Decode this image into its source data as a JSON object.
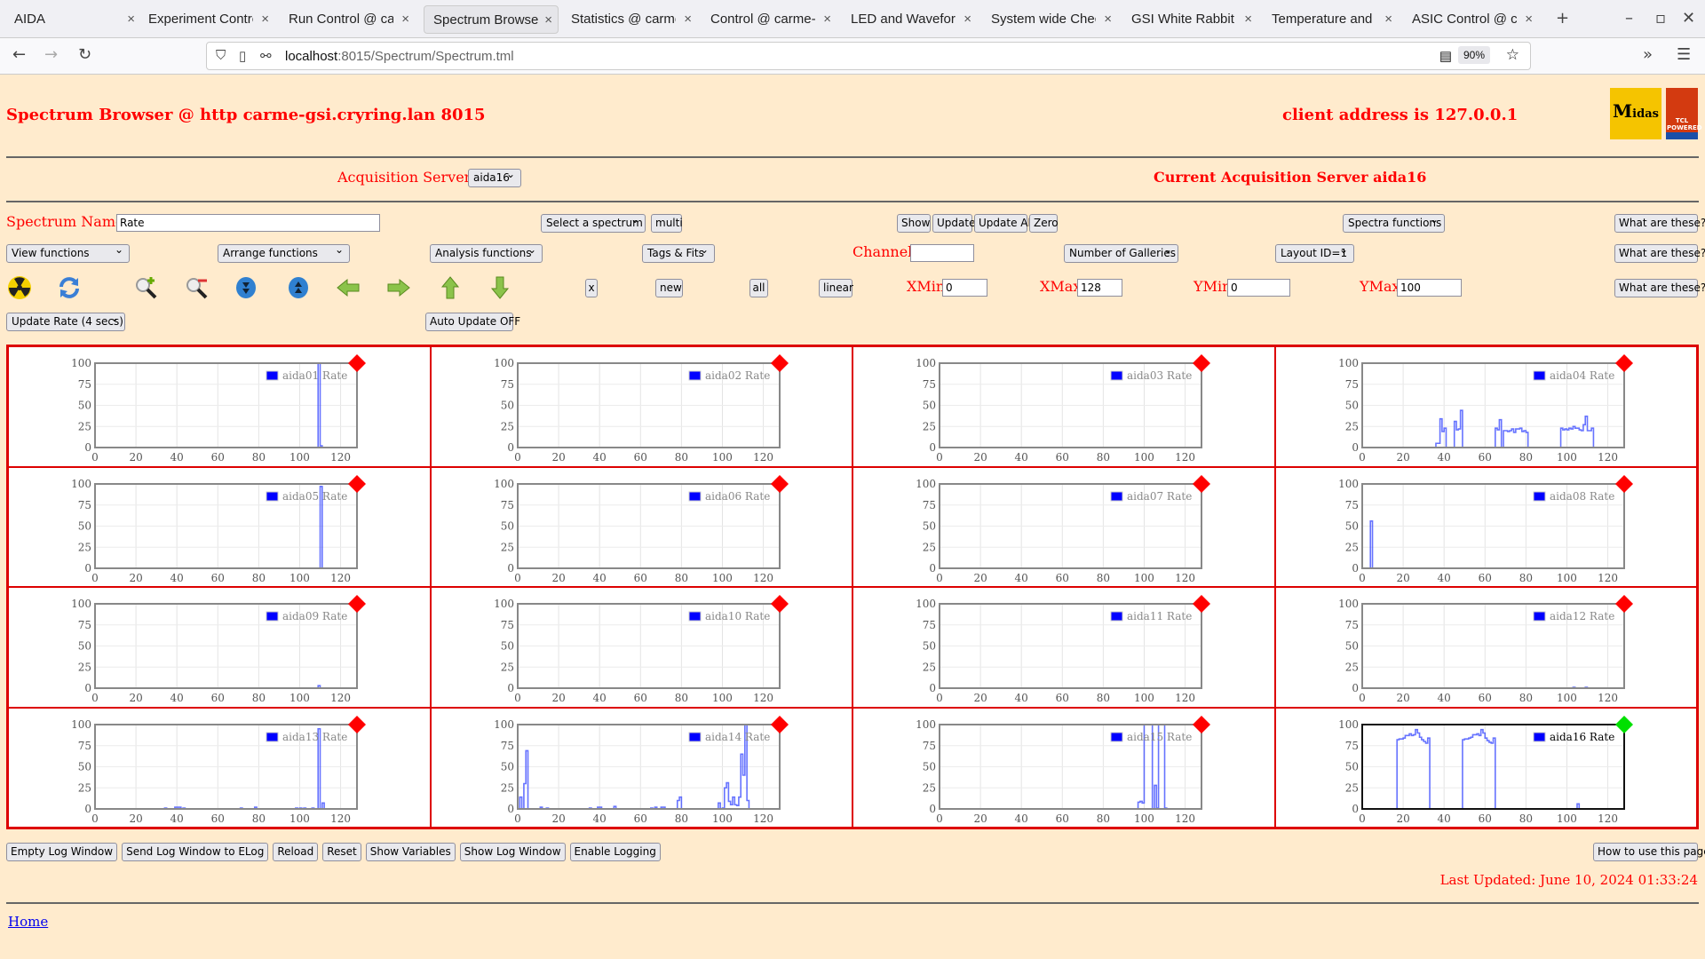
{
  "browser": {
    "tabs": [
      {
        "label": "AIDA"
      },
      {
        "label": "Experiment Control"
      },
      {
        "label": "Run Control @ carme"
      },
      {
        "label": "Spectrum Browser",
        "active": true
      },
      {
        "label": "Statistics @ carme"
      },
      {
        "label": "Control @ carme-gsi"
      },
      {
        "label": "LED and Waveform"
      },
      {
        "label": "System wide Check"
      },
      {
        "label": "GSI White Rabbit T"
      },
      {
        "label": "Temperature and st"
      },
      {
        "label": "ASIC Control @ carme"
      }
    ],
    "url_host": "localhost",
    "url_path": ":8015/Spectrum/Spectrum.tml",
    "zoom": "90%"
  },
  "header": {
    "title": "Spectrum Browser @ http carme-gsi.cryring.lan 8015",
    "client": "client address is 127.0.0.1",
    "logo_text": "Midas",
    "logo2_text": "TCL POWERED"
  },
  "acq": {
    "label": "Acquisition Servers",
    "selected": "aida16",
    "current": "Current Acquisition Server aida16"
  },
  "controls": {
    "spectrum_name_label": "Spectrum Name:",
    "spectrum_name": "Rate",
    "select_spectrum": "Select a spectrum",
    "multi": "multi",
    "show": "Show",
    "update": "Update",
    "update_all": "Update All",
    "zero": "Zero",
    "spectra_functions": "Spectra functions",
    "what": "What are these?",
    "view_functions": "View functions",
    "arrange_functions": "Arrange functions",
    "analysis_functions": "Analysis functions",
    "tags_fits": "Tags & Fits",
    "channel_label": "Channel:",
    "channel": "",
    "galleries": "Number of Galleries",
    "layout": "Layout ID=1",
    "x": "x",
    "new": "new",
    "all": "all",
    "linear": "linear",
    "xmin_label": "XMin",
    "xmin": "0",
    "xmax_label": "XMax",
    "xmax": "128",
    "ymin_label": "YMin",
    "ymin": "0",
    "ymax_label": "YMax",
    "ymax": "100",
    "update_rate": "Update Rate (4 secs)",
    "auto_update": "Auto Update OFF",
    "icons": [
      "radiation-icon",
      "refresh-icon",
      "zoom-in-icon",
      "zoom-out-icon",
      "expand-down-icon",
      "expand-up-icon",
      "arrow-left-icon",
      "arrow-right-icon",
      "arrow-up-icon",
      "arrow-down-icon"
    ]
  },
  "chart_data": [
    {
      "type": "line",
      "legend": "aida01 Rate",
      "status_color": "#ff0000",
      "xlim": [
        0,
        128
      ],
      "ylim": [
        0,
        100
      ],
      "xticks": [
        0,
        20,
        40,
        60,
        80,
        100,
        120
      ],
      "yticks": [
        0,
        25,
        50,
        75,
        100
      ],
      "nonzero_bins": [
        [
          109,
          100
        ],
        [
          110,
          2
        ]
      ]
    },
    {
      "type": "line",
      "legend": "aida02 Rate",
      "status_color": "#ff0000",
      "xlim": [
        0,
        128
      ],
      "ylim": [
        0,
        100
      ],
      "xticks": [
        0,
        20,
        40,
        60,
        80,
        100,
        120
      ],
      "yticks": [
        0,
        25,
        50,
        75,
        100
      ],
      "nonzero_bins": []
    },
    {
      "type": "line",
      "legend": "aida03 Rate",
      "status_color": "#ff0000",
      "xlim": [
        0,
        128
      ],
      "ylim": [
        0,
        100
      ],
      "xticks": [
        0,
        20,
        40,
        60,
        80,
        100,
        120
      ],
      "yticks": [
        0,
        25,
        50,
        75,
        100
      ],
      "nonzero_bins": []
    },
    {
      "type": "line",
      "legend": "aida04 Rate",
      "status_color": "#ff0000",
      "xlim": [
        0,
        128
      ],
      "ylim": [
        0,
        100
      ],
      "xticks": [
        0,
        20,
        40,
        60,
        80,
        100,
        120
      ],
      "yticks": [
        0,
        25,
        50,
        75,
        100
      ],
      "nonzero_bins": [
        [
          36,
          5
        ],
        [
          37,
          5
        ],
        [
          38,
          34
        ],
        [
          39,
          19
        ],
        [
          40,
          23
        ],
        [
          45,
          31
        ],
        [
          46,
          21
        ],
        [
          47,
          22
        ],
        [
          48,
          44
        ],
        [
          65,
          23
        ],
        [
          66,
          21
        ],
        [
          67,
          33
        ],
        [
          69,
          20
        ],
        [
          70,
          20
        ],
        [
          71,
          19
        ],
        [
          72,
          20
        ],
        [
          73,
          22
        ],
        [
          74,
          18
        ],
        [
          75,
          22
        ],
        [
          76,
          22
        ],
        [
          77,
          23
        ],
        [
          78,
          19
        ],
        [
          79,
          20
        ],
        [
          80,
          18
        ],
        [
          97,
          23
        ],
        [
          98,
          21
        ],
        [
          99,
          22
        ],
        [
          100,
          21
        ],
        [
          101,
          23
        ],
        [
          102,
          22
        ],
        [
          103,
          25
        ],
        [
          104,
          23
        ],
        [
          105,
          23
        ],
        [
          106,
          21
        ],
        [
          107,
          20
        ],
        [
          108,
          27
        ],
        [
          109,
          37
        ],
        [
          110,
          20
        ],
        [
          111,
          20
        ],
        [
          112,
          23
        ]
      ]
    },
    {
      "type": "line",
      "legend": "aida05 Rate",
      "status_color": "#ff0000",
      "xlim": [
        0,
        128
      ],
      "ylim": [
        0,
        100
      ],
      "xticks": [
        0,
        20,
        40,
        60,
        80,
        100,
        120
      ],
      "yticks": [
        0,
        25,
        50,
        75,
        100
      ],
      "nonzero_bins": [
        [
          110,
          97
        ]
      ]
    },
    {
      "type": "line",
      "legend": "aida06 Rate",
      "status_color": "#ff0000",
      "xlim": [
        0,
        128
      ],
      "ylim": [
        0,
        100
      ],
      "xticks": [
        0,
        20,
        40,
        60,
        80,
        100,
        120
      ],
      "yticks": [
        0,
        25,
        50,
        75,
        100
      ],
      "nonzero_bins": []
    },
    {
      "type": "line",
      "legend": "aida07 Rate",
      "status_color": "#ff0000",
      "xlim": [
        0,
        128
      ],
      "ylim": [
        0,
        100
      ],
      "xticks": [
        0,
        20,
        40,
        60,
        80,
        100,
        120
      ],
      "yticks": [
        0,
        25,
        50,
        75,
        100
      ],
      "nonzero_bins": []
    },
    {
      "type": "line",
      "legend": "aida08 Rate",
      "status_color": "#ff0000",
      "xlim": [
        0,
        128
      ],
      "ylim": [
        0,
        100
      ],
      "xticks": [
        0,
        20,
        40,
        60,
        80,
        100,
        120
      ],
      "yticks": [
        0,
        25,
        50,
        75,
        100
      ],
      "nonzero_bins": [
        [
          4,
          56
        ]
      ]
    },
    {
      "type": "line",
      "legend": "aida09 Rate",
      "status_color": "#ff0000",
      "xlim": [
        0,
        128
      ],
      "ylim": [
        0,
        100
      ],
      "xticks": [
        0,
        20,
        40,
        60,
        80,
        100,
        120
      ],
      "yticks": [
        0,
        25,
        50,
        75,
        100
      ],
      "nonzero_bins": [
        [
          109,
          3
        ]
      ]
    },
    {
      "type": "line",
      "legend": "aida10 Rate",
      "status_color": "#ff0000",
      "xlim": [
        0,
        128
      ],
      "ylim": [
        0,
        100
      ],
      "xticks": [
        0,
        20,
        40,
        60,
        80,
        100,
        120
      ],
      "yticks": [
        0,
        25,
        50,
        75,
        100
      ],
      "nonzero_bins": []
    },
    {
      "type": "line",
      "legend": "aida11 Rate",
      "status_color": "#ff0000",
      "xlim": [
        0,
        128
      ],
      "ylim": [
        0,
        100
      ],
      "xticks": [
        0,
        20,
        40,
        60,
        80,
        100,
        120
      ],
      "yticks": [
        0,
        25,
        50,
        75,
        100
      ],
      "nonzero_bins": []
    },
    {
      "type": "line",
      "legend": "aida12 Rate",
      "status_color": "#ff0000",
      "xlim": [
        0,
        128
      ],
      "ylim": [
        0,
        100
      ],
      "xticks": [
        0,
        20,
        40,
        60,
        80,
        100,
        120
      ],
      "yticks": [
        0,
        25,
        50,
        75,
        100
      ],
      "nonzero_bins": [
        [
          103,
          1
        ],
        [
          109,
          1
        ]
      ]
    },
    {
      "type": "line",
      "legend": "aida13 Rate",
      "status_color": "#ff0000",
      "xlim": [
        0,
        128
      ],
      "ylim": [
        0,
        100
      ],
      "xticks": [
        0,
        20,
        40,
        60,
        80,
        100,
        120
      ],
      "yticks": [
        0,
        25,
        50,
        75,
        100
      ],
      "nonzero_bins": [
        [
          34,
          1
        ],
        [
          39,
          2
        ],
        [
          40,
          2
        ],
        [
          41,
          2
        ],
        [
          43,
          1
        ],
        [
          71,
          1
        ],
        [
          78,
          2
        ],
        [
          98,
          1
        ],
        [
          100,
          1
        ],
        [
          102,
          1
        ],
        [
          106,
          1
        ],
        [
          109,
          95
        ],
        [
          111,
          7
        ]
      ]
    },
    {
      "type": "line",
      "legend": "aida14 Rate",
      "status_color": "#ff0000",
      "xlim": [
        0,
        128
      ],
      "ylim": [
        0,
        100
      ],
      "xticks": [
        0,
        20,
        40,
        60,
        80,
        100,
        120
      ],
      "yticks": [
        0,
        25,
        50,
        75,
        100
      ],
      "nonzero_bins": [
        [
          1,
          14
        ],
        [
          3,
          30
        ],
        [
          4,
          69
        ],
        [
          11,
          2
        ],
        [
          14,
          1
        ],
        [
          35,
          1
        ],
        [
          39,
          2
        ],
        [
          40,
          2
        ],
        [
          47,
          3
        ],
        [
          65,
          1
        ],
        [
          67,
          2
        ],
        [
          70,
          2
        ],
        [
          71,
          2
        ],
        [
          78,
          10
        ],
        [
          79,
          14
        ],
        [
          98,
          7
        ],
        [
          100,
          1
        ],
        [
          101,
          1
        ],
        [
          101,
          25
        ],
        [
          102,
          31
        ],
        [
          103,
          9
        ],
        [
          104,
          5
        ],
        [
          105,
          14
        ],
        [
          106,
          5
        ],
        [
          107,
          4
        ],
        [
          108,
          14
        ],
        [
          109,
          65
        ],
        [
          110,
          40
        ],
        [
          111,
          100
        ],
        [
          112,
          10
        ]
      ]
    },
    {
      "type": "line",
      "legend": "aida15 Rate",
      "status_color": "#ff0000",
      "xlim": [
        0,
        128
      ],
      "ylim": [
        0,
        100
      ],
      "xticks": [
        0,
        20,
        40,
        60,
        80,
        100,
        120
      ],
      "yticks": [
        0,
        25,
        50,
        75,
        100
      ],
      "nonzero_bins": [
        [
          97,
          8
        ],
        [
          98,
          9
        ],
        [
          99,
          7
        ],
        [
          100,
          100
        ],
        [
          101,
          100
        ],
        [
          102,
          100
        ],
        [
          103,
          100
        ],
        [
          105,
          28
        ],
        [
          106,
          1
        ],
        [
          107,
          100
        ],
        [
          108,
          100
        ],
        [
          109,
          100
        ],
        [
          110,
          1
        ]
      ]
    },
    {
      "type": "line",
      "legend": "aida16 Rate",
      "status_color": "#00e000",
      "selected": true,
      "xlim": [
        0,
        128
      ],
      "ylim": [
        0,
        100
      ],
      "xticks": [
        0,
        20,
        40,
        60,
        80,
        100,
        120
      ],
      "yticks": [
        0,
        25,
        50,
        75,
        100
      ],
      "nonzero_bins": [
        [
          17,
          82
        ],
        [
          18,
          83
        ],
        [
          19,
          83
        ],
        [
          20,
          84
        ],
        [
          21,
          87
        ],
        [
          22,
          87
        ],
        [
          23,
          89
        ],
        [
          24,
          87
        ],
        [
          25,
          88
        ],
        [
          26,
          94
        ],
        [
          27,
          90
        ],
        [
          28,
          85
        ],
        [
          29,
          82
        ],
        [
          30,
          80
        ],
        [
          31,
          78
        ],
        [
          32,
          84
        ],
        [
          49,
          82
        ],
        [
          50,
          83
        ],
        [
          51,
          83
        ],
        [
          52,
          84
        ],
        [
          53,
          85
        ],
        [
          54,
          88
        ],
        [
          55,
          88
        ],
        [
          56,
          89
        ],
        [
          57,
          87
        ],
        [
          58,
          94
        ],
        [
          59,
          90
        ],
        [
          60,
          84
        ],
        [
          61,
          81
        ],
        [
          62,
          79
        ],
        [
          63,
          78
        ],
        [
          64,
          84
        ],
        [
          105,
          6
        ]
      ]
    }
  ],
  "footer": {
    "buttons": [
      "Empty Log Window",
      "Send Log Window to ELog",
      "Reload",
      "Reset",
      "Show Variables",
      "Show Log Window",
      "Enable Logging"
    ],
    "help": "How to use this page",
    "last_updated": "Last Updated: June 10, 2024 01:33:24",
    "home": "Home"
  }
}
